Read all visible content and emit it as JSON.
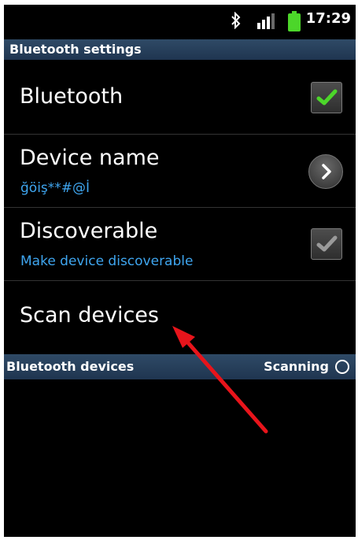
{
  "status_bar": {
    "time": "17:29",
    "icons": [
      "bluetooth-icon",
      "signal-icon",
      "battery-icon"
    ],
    "battery_color": "#4cd62a"
  },
  "settings_header": "Bluetooth settings",
  "rows": {
    "bluetooth": {
      "title": "Bluetooth",
      "checked": true
    },
    "device_name": {
      "title": "Device name",
      "value": "ğöiş**#@İ"
    },
    "discoverable": {
      "title": "Discoverable",
      "subtitle": "Make device discoverable",
      "checked": true
    },
    "scan": {
      "title": "Scan devices"
    }
  },
  "devices_header": {
    "label": "Bluetooth devices",
    "status": "Scanning"
  },
  "colors": {
    "accent_blue": "#3fa6f0",
    "check_green": "#4cd62a",
    "check_disabled": "#9a9a9a",
    "header_bg": "#2f4a66",
    "annotation_red": "#e8141b"
  }
}
